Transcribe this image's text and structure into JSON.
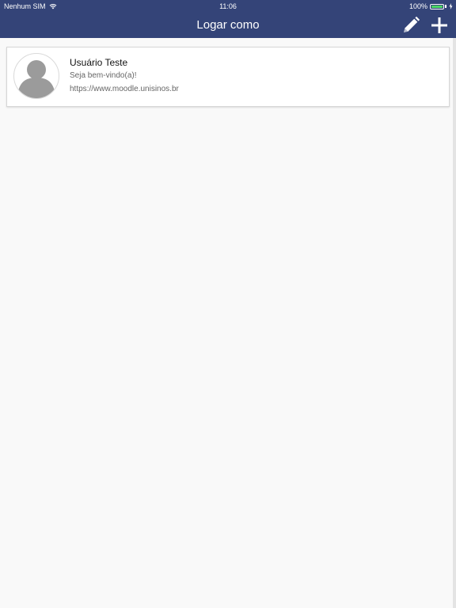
{
  "status_bar": {
    "carrier": "Nenhum SIM",
    "time": "11:06",
    "battery": "100%",
    "wifi_icon": "wifi-icon",
    "battery_icon": "battery-icon",
    "charging_icon": "charging-bolt-icon"
  },
  "header": {
    "title": "Logar como",
    "edit_icon": "pencil-icon",
    "add_icon": "plus-icon",
    "background": "#344478"
  },
  "accounts": [
    {
      "name": "Usuário Teste",
      "greeting": "Seja bem-vindo(a)!",
      "site": "https://www.moodle.unisinos.br",
      "avatar_icon": "user-avatar-icon"
    }
  ]
}
